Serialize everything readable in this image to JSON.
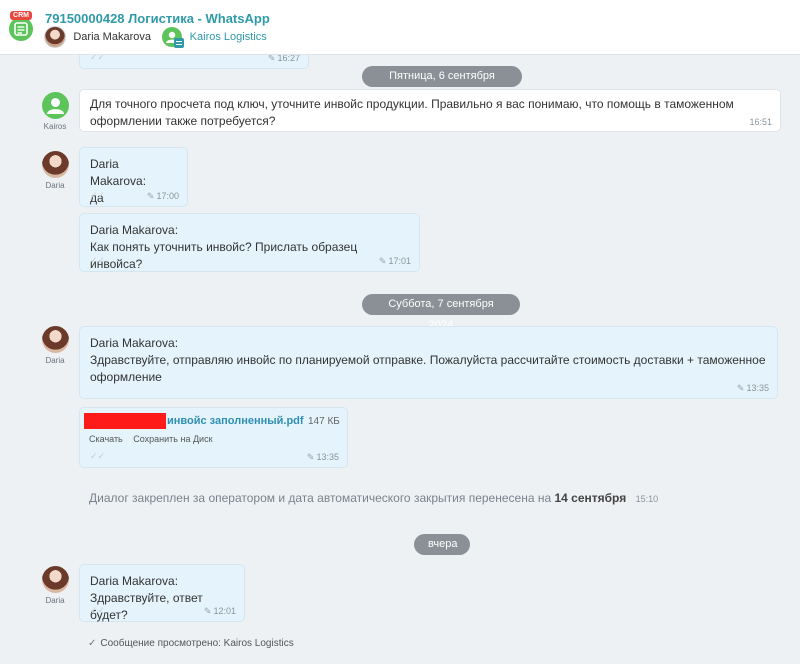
{
  "header": {
    "app_badge": "CRM",
    "title": "79150000428 Логистика - WhatsApp",
    "participants": [
      {
        "name": "Daria Makarova"
      },
      {
        "name": "Kairos Logistics"
      }
    ]
  },
  "colors": {
    "accent": "#2f9aa8",
    "bubble_out": "#e5f4fc",
    "bubble_in": "#ffffff",
    "date_pill": "#8a9096",
    "redaction": "#ff1a1a",
    "bot_avatar": "#5cc45a"
  },
  "feed": {
    "partial_time": "16:27",
    "date1": "Пятница, 6 сентября 2024",
    "msg1": {
      "sender": "Kairos",
      "line1": "Для точного просчета под ключ, уточните инвойс продукции. Правильно я вас понимаю, что помощь в таможенном",
      "line2": "оформлении также потребуется?",
      "time": "16:51"
    },
    "msg2": {
      "sender": "Daria",
      "author": "Daria Makarova:",
      "text": "да",
      "time": "17:00"
    },
    "msg3": {
      "author": "Daria Makarova:",
      "text": "Как понять уточнить инвойс? Прислать образец инвойса?",
      "time": "17:01"
    },
    "date2": "Суббота, 7 сентября 2024",
    "msg4": {
      "sender": "Daria",
      "author": "Daria Makarova:",
      "line1": "Здравствуйте, отправляю инвойс по планируемой отправке. Пожалуйста рассчитайте стоимость доставки + таможенное",
      "line2": "оформление",
      "time": "13:35"
    },
    "file": {
      "name": "инвойс заполненный.pdf",
      "size": "147 КБ",
      "download": "Скачать",
      "save": "Сохранить на Диск",
      "time": "13:35"
    },
    "system": {
      "text": "Диалог закреплен за оператором и дата автоматического закрытия перенесена на",
      "date": "14 сентября",
      "time": "15:10"
    },
    "date3": "вчера",
    "msg5": {
      "sender": "Daria",
      "author": "Daria Makarova:",
      "text": "Здравствуйте, ответ будет?",
      "time": "12:01"
    },
    "seen": "Сообщение просмотрено: Kairos Logistics"
  }
}
